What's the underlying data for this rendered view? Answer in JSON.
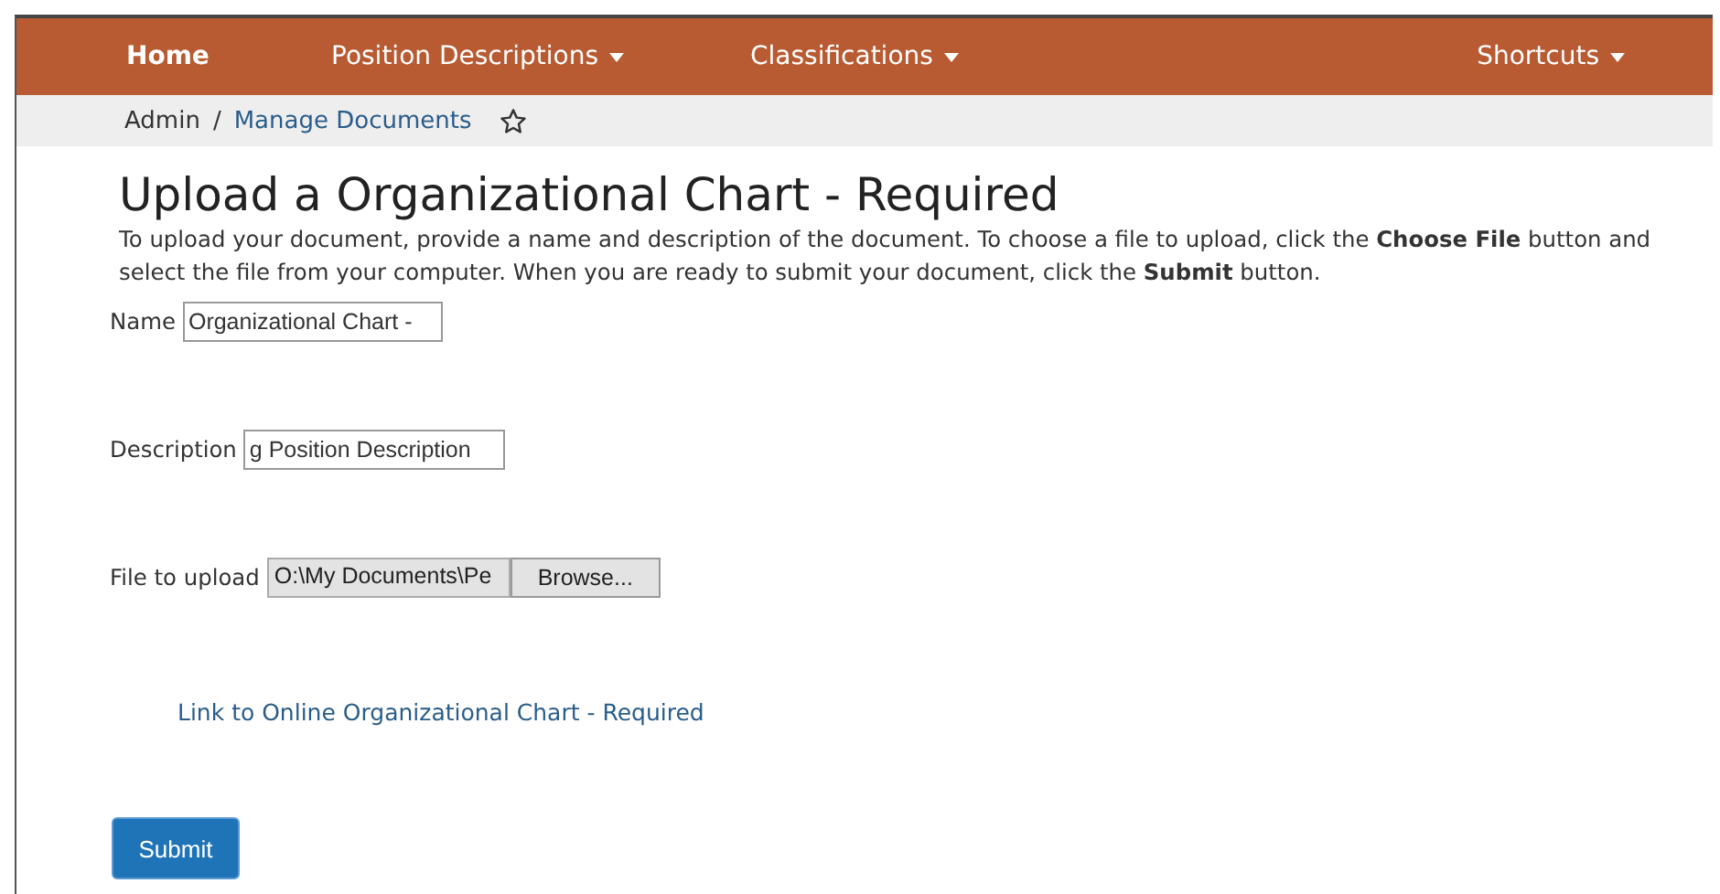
{
  "nav": {
    "items": [
      {
        "label": "Home",
        "kind": "link",
        "selected": true
      },
      {
        "label": "Position Descriptions",
        "kind": "dropdown",
        "selected": false
      },
      {
        "label": "Classifications",
        "kind": "dropdown",
        "selected": false
      }
    ],
    "right": {
      "label": "Shortcuts",
      "kind": "dropdown"
    }
  },
  "breadcrumb": {
    "items": [
      {
        "label": "Admin",
        "kind": "text"
      },
      {
        "label": "Manage Documents",
        "kind": "link"
      }
    ],
    "separator": "/",
    "favorite": false
  },
  "heading": "Upload a Organizational Chart - Required",
  "instructions": "To upload your document, provide a name and description of the document.  To choose a file to upload, click the **Choose File** button and select the file from your computer.  When you are ready to submit your document, click the **Submit** button.",
  "form": {
    "fields": [
      {
        "label": "Name",
        "kind": "text",
        "value": "Organizational Chart -"
      },
      {
        "label": "Description",
        "kind": "text",
        "value": "g Position Description"
      },
      {
        "label": "File to upload",
        "kind": "file",
        "value": "O:\\My Documents\\Pe",
        "button": "Browse..."
      }
    ]
  },
  "link": "Link to Online Organizational Chart - Required",
  "submit": "Submit"
}
